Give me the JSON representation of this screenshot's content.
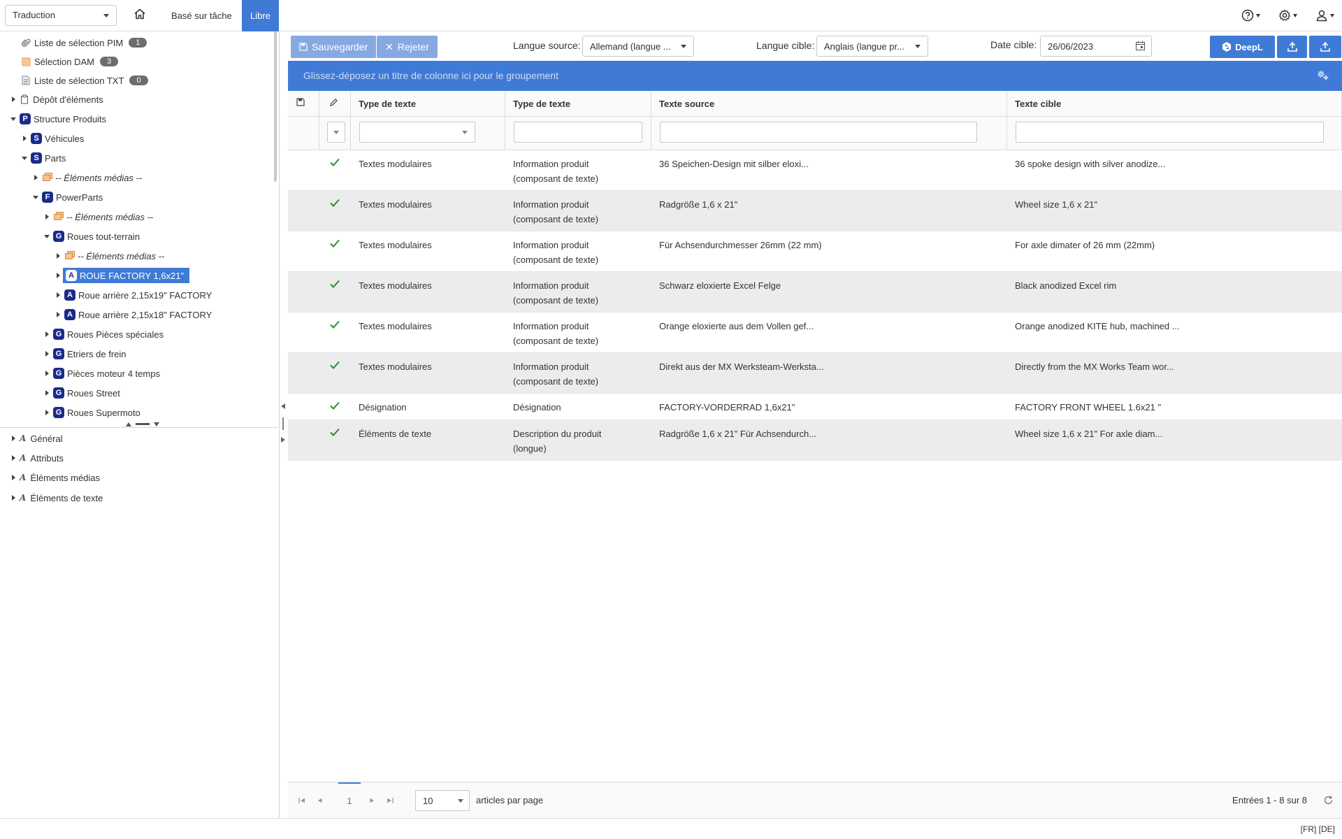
{
  "topbar": {
    "module_select": "Traduction",
    "tabs": [
      {
        "label": "Basé sur tâche",
        "active": false
      },
      {
        "label": "Libre",
        "active": true
      }
    ]
  },
  "tree": {
    "nodes": [
      {
        "label": "Liste de sélection PIM",
        "count": "1",
        "icon": "paperclip-icon"
      },
      {
        "label": "Sélection DAM",
        "count": "3",
        "icon": "image-icon"
      },
      {
        "label": "Liste de sélection TXT",
        "count": "0",
        "icon": "document-icon"
      },
      {
        "label": "Dépôt d'éléments",
        "icon": "clipboard-icon"
      },
      {
        "label": "Structure Produits",
        "letter": "P"
      },
      {
        "label": "Véhicules",
        "letter": "S"
      },
      {
        "label": "Parts",
        "letter": "S"
      },
      {
        "label": "-- Éléments médias --"
      },
      {
        "label": "PowerParts",
        "letter": "F"
      },
      {
        "label": "-- Éléments médias --"
      },
      {
        "label": "Roues tout-terrain",
        "letter": "G"
      },
      {
        "label": "-- Éléments médias --"
      },
      {
        "label": "ROUE FACTORY 1,6x21\"",
        "letter": "A",
        "selected": true
      },
      {
        "label": "Roue arrière 2,15x19\" FACTORY",
        "letter": "A"
      },
      {
        "label": "Roue arrière 2,15x18\" FACTORY",
        "letter": "A"
      },
      {
        "label": "Roues Pièces spéciales",
        "letter": "G"
      },
      {
        "label": "Etriers de frein",
        "letter": "G"
      },
      {
        "label": "Pièces moteur 4 temps",
        "letter": "G"
      },
      {
        "label": "Roues Street",
        "letter": "G"
      },
      {
        "label": "Roues Supermoto",
        "letter": "G"
      }
    ],
    "attributes": [
      "Général",
      "Attributs",
      "Éléments médias",
      "Éléments de texte"
    ]
  },
  "toolbar": {
    "save_label": "Sauvegarder",
    "reject_label": "Rejeter",
    "source_lang_label": "Langue source:",
    "source_lang_value": "Allemand (langue ...",
    "target_lang_label": "Langue cible:",
    "target_lang_value": "Anglais (langue pr...",
    "target_date_label": "Date cible:",
    "target_date_value": "26/06/2023",
    "deepl_label": "DeepL"
  },
  "groupbar": {
    "hint": "Glissez-déposez un titre de colonne ici pour le groupement"
  },
  "grid": {
    "columns": [
      "Type de texte",
      "Type de texte",
      "Texte source",
      "Texte cible"
    ],
    "rows": [
      {
        "checked": true,
        "type1": "Textes modulaires",
        "type2": "Information produit (composant de texte)",
        "source": "36 Speichen-Design mit silber eloxi...",
        "target": "36 spoke design with silver anodize..."
      },
      {
        "checked": true,
        "type1": "Textes modulaires",
        "type2": "Information produit (composant de texte)",
        "source": "Radgröße 1,6 x 21\"",
        "target": "Wheel size 1,6 x 21\""
      },
      {
        "checked": true,
        "type1": "Textes modulaires",
        "type2": "Information produit (composant de texte)",
        "source": "Für Achsendurchmesser 26mm (22 mm)",
        "target": "For axle dimater of 26 mm (22mm)"
      },
      {
        "checked": true,
        "type1": "Textes modulaires",
        "type2": "Information produit (composant de texte)",
        "source": "Schwarz eloxierte Excel Felge",
        "target": "Black anodized Excel rim"
      },
      {
        "checked": true,
        "type1": "Textes modulaires",
        "type2": "Information produit (composant de texte)",
        "source": "Orange eloxierte aus dem Vollen gef...",
        "target": "Orange anodized KITE hub, machined ..."
      },
      {
        "checked": true,
        "type1": "Textes modulaires",
        "type2": "Information produit (composant de texte)",
        "source": "Direkt aus der MX Werksteam-Werksta...",
        "target": "Directly from the MX Works Team wor..."
      },
      {
        "checked": true,
        "type1": "Désignation",
        "type2": "Désignation",
        "source": "FACTORY-VORDERRAD 1,6x21\"",
        "target": "FACTORY FRONT WHEEL 1.6x21 \""
      },
      {
        "checked": true,
        "type1": "Éléments de texte",
        "type2": "Description du produit (longue)",
        "source": "Radgröße 1,6 x 21\" Für Achsendurch...",
        "target": "Wheel size 1,6 x 21\" For axle diam..."
      }
    ]
  },
  "pager": {
    "current_page": "1",
    "page_size": "10",
    "per_page_label": "articles par page",
    "entries_label": "Entrées 1 - 8 sur 8"
  },
  "statusbar": {
    "locale": "[FR] [DE]"
  },
  "colors": {
    "accent": "#3f7bd6",
    "node_badge": "#1b2a8c",
    "check": "#2e8b2e"
  }
}
